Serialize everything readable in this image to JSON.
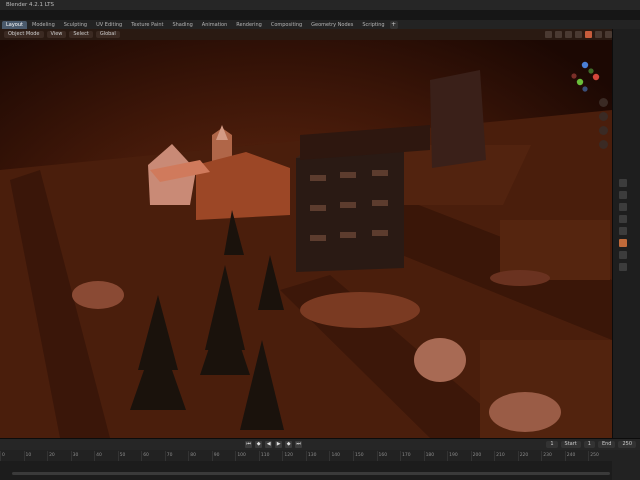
{
  "window": {
    "title": "Blender 4.2.1 LTS"
  },
  "tabs": [
    {
      "label": "Layout",
      "active": true
    },
    {
      "label": "Modeling"
    },
    {
      "label": "Sculpting"
    },
    {
      "label": "UV Editing"
    },
    {
      "label": "Texture Paint"
    },
    {
      "label": "Shading"
    },
    {
      "label": "Animation"
    },
    {
      "label": "Rendering"
    },
    {
      "label": "Compositing"
    },
    {
      "label": "Geometry Nodes"
    },
    {
      "label": "Scripting"
    }
  ],
  "add_tab_label": "+",
  "viewport_header": {
    "mode_label": "Object Mode",
    "view_label": "View",
    "select_label": "Select",
    "global_label": "Global"
  },
  "timeline": {
    "start_label": "Start",
    "start_value": "1",
    "end_label": "End",
    "end_value": "250",
    "current_frame": "1",
    "ticks": [
      "0",
      "10",
      "20",
      "30",
      "40",
      "50",
      "60",
      "70",
      "80",
      "90",
      "100",
      "110",
      "120",
      "130",
      "140",
      "150",
      "160",
      "170",
      "180",
      "190",
      "200",
      "210",
      "220",
      "230",
      "240",
      "250"
    ]
  },
  "colors": {
    "accent": "#c65c3c",
    "scene_tint": "#5a2410",
    "active_tab": "#4a5a6c"
  }
}
